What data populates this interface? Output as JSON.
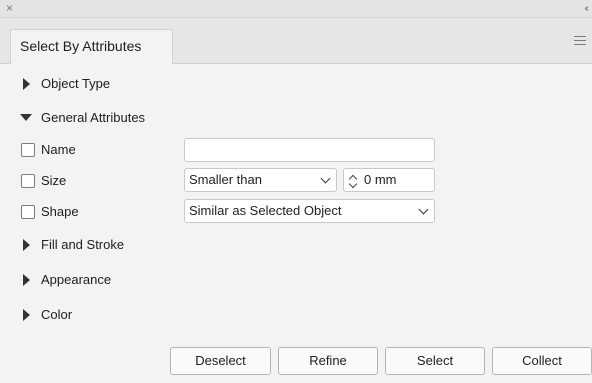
{
  "window": {
    "close_glyph": "×",
    "collapse_glyph": "‹‹"
  },
  "tab": {
    "title": "Select By Attributes"
  },
  "sections": {
    "object_type": "Object Type",
    "general_attributes": "General Attributes",
    "fill_and_stroke": "Fill and Stroke",
    "appearance": "Appearance",
    "color": "Color"
  },
  "attributes": {
    "name": {
      "label": "Name",
      "checked": false,
      "value": ""
    },
    "size": {
      "label": "Size",
      "checked": false,
      "comparison": "Smaller than",
      "value": "0 mm"
    },
    "shape": {
      "label": "Shape",
      "checked": false,
      "comparison": "Similar as Selected Object"
    }
  },
  "buttons": {
    "deselect": "Deselect",
    "refine": "Refine",
    "select": "Select",
    "collect": "Collect"
  },
  "icons": [
    "close-icon",
    "collapse-panel-icon",
    "panel-menu-icon",
    "disclosure-triangle-icon",
    "chevron-down-icon",
    "stepper-icon"
  ]
}
